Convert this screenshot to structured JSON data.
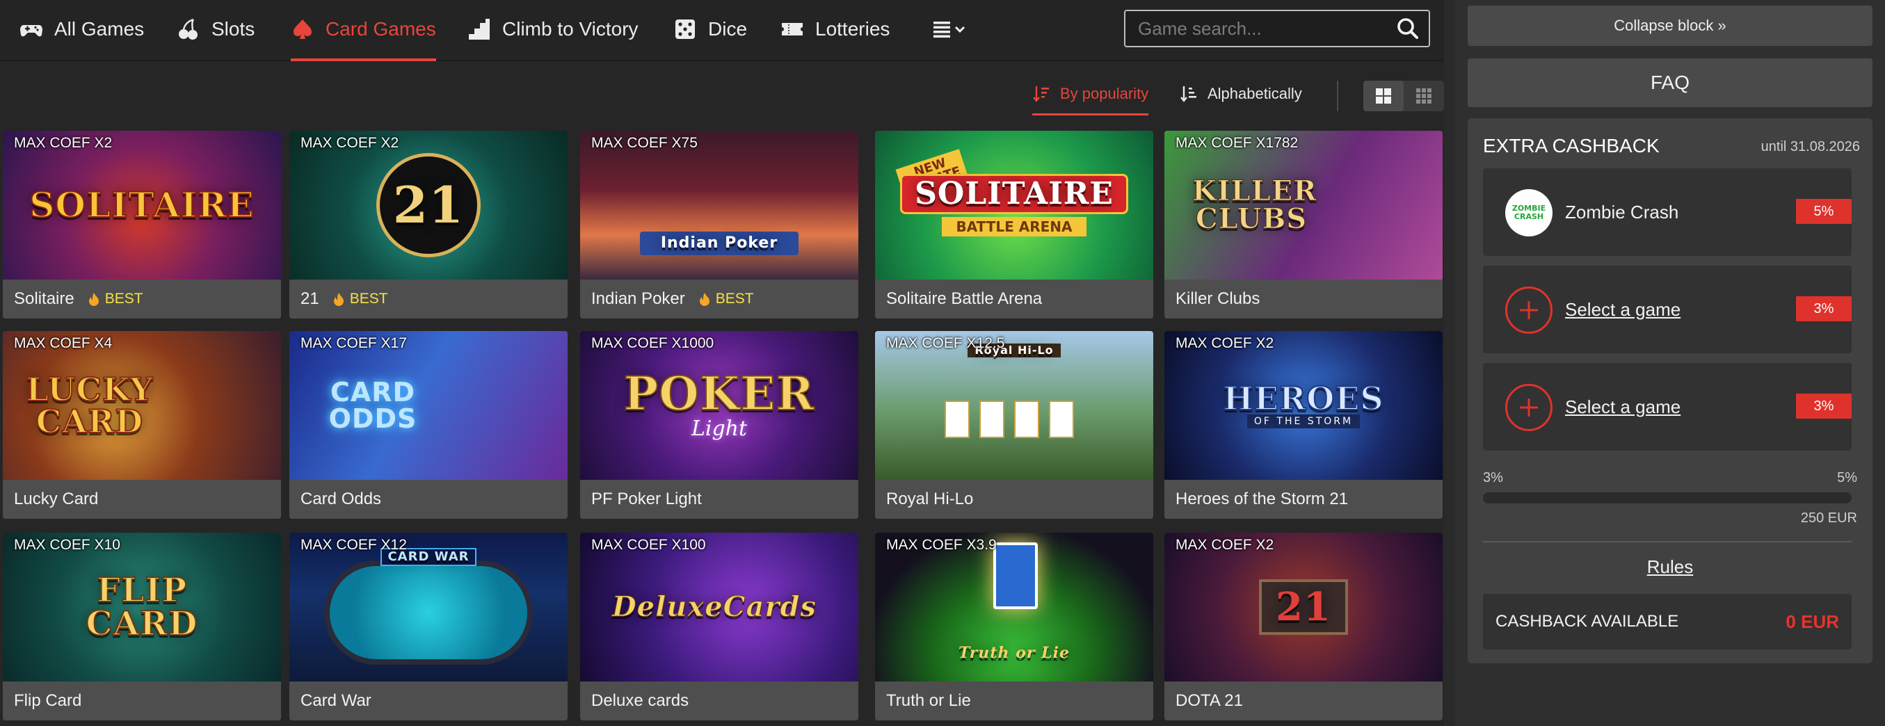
{
  "nav": {
    "items": [
      {
        "label": "All Games",
        "icon": "gamepad-icon"
      },
      {
        "label": "Slots",
        "icon": "cherries-icon"
      },
      {
        "label": "Card Games",
        "icon": "spade-icon",
        "active": true
      },
      {
        "label": "Climb to Victory",
        "icon": "stairs-icon"
      },
      {
        "label": "Dice",
        "icon": "dice-icon"
      },
      {
        "label": "Lotteries",
        "icon": "ticket-icon"
      }
    ],
    "more_icon": "list-dropdown-icon"
  },
  "search": {
    "placeholder": "Game search..."
  },
  "sort": {
    "popularity": "By popularity",
    "alphabetical": "Alphabetically",
    "active": "popularity"
  },
  "games": [
    {
      "coef": "MAX COEF X2",
      "name": "Solitaire",
      "best": "BEST",
      "art": "SOLITAIRE"
    },
    {
      "coef": "MAX COEF X2",
      "name": "21",
      "best": "BEST",
      "art": "21"
    },
    {
      "coef": "MAX COEF X75",
      "name": "Indian Poker",
      "best": "BEST",
      "art": "Indian Poker"
    },
    {
      "coef": "",
      "name": "Solitaire Battle Arena",
      "best": "",
      "art": "SOLITAIRE",
      "art_sub": "BATTLE ARENA",
      "ribbon": "NEW UPDATE"
    },
    {
      "coef": "MAX COEF X1782",
      "name": "Killer Clubs",
      "best": "",
      "art": "KILLER CLUBS"
    },
    {
      "coef": "MAX COEF X4",
      "name": "Lucky Card",
      "best": "",
      "art": "LUCKY CARD"
    },
    {
      "coef": "MAX COEF X17",
      "name": "Card Odds",
      "best": "",
      "art": "CARD ODDS"
    },
    {
      "coef": "MAX COEF X1000",
      "name": "PF Poker Light",
      "best": "",
      "art": "POKER",
      "art_sub": "Light"
    },
    {
      "coef": "MAX COEF X12.5",
      "name": "Royal Hi-Lo",
      "best": "",
      "art": "Royal Hi-Lo"
    },
    {
      "coef": "MAX COEF X2",
      "name": "Heroes of the Storm 21",
      "best": "",
      "art": "HEROES",
      "art_sub": "OF THE STORM"
    },
    {
      "coef": "MAX COEF X10",
      "name": "Flip Card",
      "best": "",
      "art": "FLIP CARD"
    },
    {
      "coef": "MAX COEF X12",
      "name": "Card War",
      "best": "",
      "art": "CARD WAR"
    },
    {
      "coef": "MAX COEF X100",
      "name": "Deluxe cards",
      "best": "",
      "art": "DeluxeCards"
    },
    {
      "coef": "MAX COEF X3.9",
      "name": "Truth or Lie",
      "best": "",
      "art": "Truth or Lie"
    },
    {
      "coef": "MAX COEF X2",
      "name": "DOTA 21",
      "best": "",
      "art": "21"
    }
  ],
  "sidebar": {
    "collapse_label": "Collapse block »",
    "faq_label": "FAQ",
    "cashback": {
      "title": "EXTRA CASHBACK",
      "until": "until 31.08.2026",
      "rows": [
        {
          "label": "Zombie Crash",
          "pct": "5%",
          "logo_text": "ZOMBIE CRASH"
        },
        {
          "label": "Select a game",
          "pct": "3%"
        },
        {
          "label": "Select a game",
          "pct": "3%"
        }
      ],
      "range_min": "3%",
      "range_max": "5%",
      "progress": 0,
      "range_amount": "250 EUR",
      "rules_label": "Rules",
      "available_label": "CASHBACK AVAILABLE",
      "available_value": "0 EUR"
    }
  },
  "colors": {
    "accent": "#e8453c",
    "best": "#f5e04a",
    "badge": "#e0322c"
  }
}
